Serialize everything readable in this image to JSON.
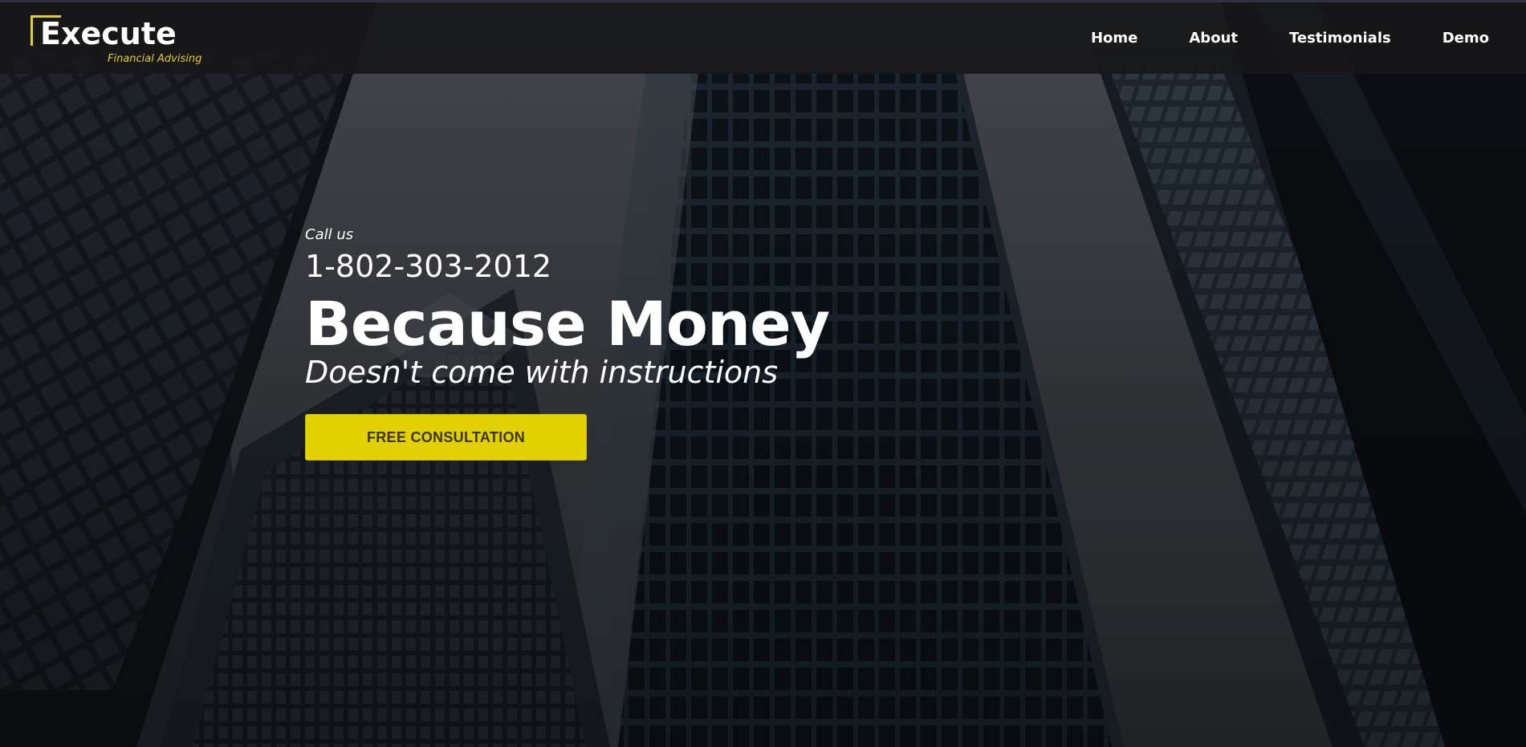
{
  "brand": {
    "name": "Execute",
    "tagline": "Financial Advising",
    "accent_color": "#e3d000"
  },
  "nav": {
    "items": [
      {
        "label": "Home"
      },
      {
        "label": "About"
      },
      {
        "label": "Testimonials"
      },
      {
        "label": "Demo"
      }
    ]
  },
  "hero": {
    "call_label": "Call us",
    "phone": "1-802-303-2012",
    "headline": "Because Money",
    "subheadline": "Doesn't come with instructions",
    "cta_label": "FREE CONSULTATION",
    "background": "city-skyscrapers-photo"
  }
}
